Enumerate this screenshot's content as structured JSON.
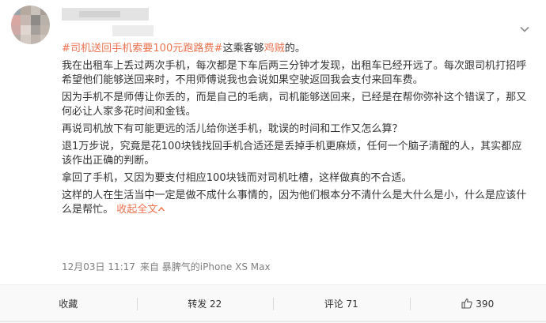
{
  "post": {
    "topic": "#司机送回手机索要100元跑路费#",
    "headline_before": "这乘客够",
    "headline_highlight": "鸡贼",
    "headline_after": "的。",
    "paragraphs": [
      "我在出租车上丢过两次手机，每次都是下车后两三分钟才发现，出租车已经开远了。每次跟司机打招呼希望他们能够送回来时，不用师傅说我也会说如果空驶返回我会支付来回车费。",
      "因为手机不是师傅让你丢的，而是自己的毛病，司机能够送回来，已经是在帮你弥补这个错误了，那又何必让人家多花时间和金钱。",
      "再说司机放下有可能更远的活儿给你送手机，耽误的时间和工作又怎么算？",
      "退1万步说，究竟是花100块钱找回手机合适还是丢掉手机更麻烦，任何一个脑子清醒的人，其实都应该作出正确的判断。",
      "拿回了手机，又因为要支付相应100块钱而对司机吐槽，这样做真的不合适。"
    ],
    "last_paragraph": "这样的人在生活当中一定是做不成什么事情的，因为他们根本分不清什么是大什么是小，什么是应该什么是帮忙。",
    "collapse_label": "收起全文"
  },
  "meta": {
    "date": "12月03日 11:17",
    "source_prefix": "来自",
    "source": "暴脾气的iPhone XS Max"
  },
  "actions": {
    "favorite": "收藏",
    "repost": "转发 22",
    "comment": "评论 71",
    "like": "390"
  },
  "colors": {
    "accent": "#eb7350",
    "text": "#333333",
    "meta": "#808080",
    "action_bar_bg": "#f9f9f9"
  },
  "icons": {
    "menu": "chevron-down-icon",
    "collapse": "collapse-up-icon",
    "like": "thumbs-up-icon"
  }
}
